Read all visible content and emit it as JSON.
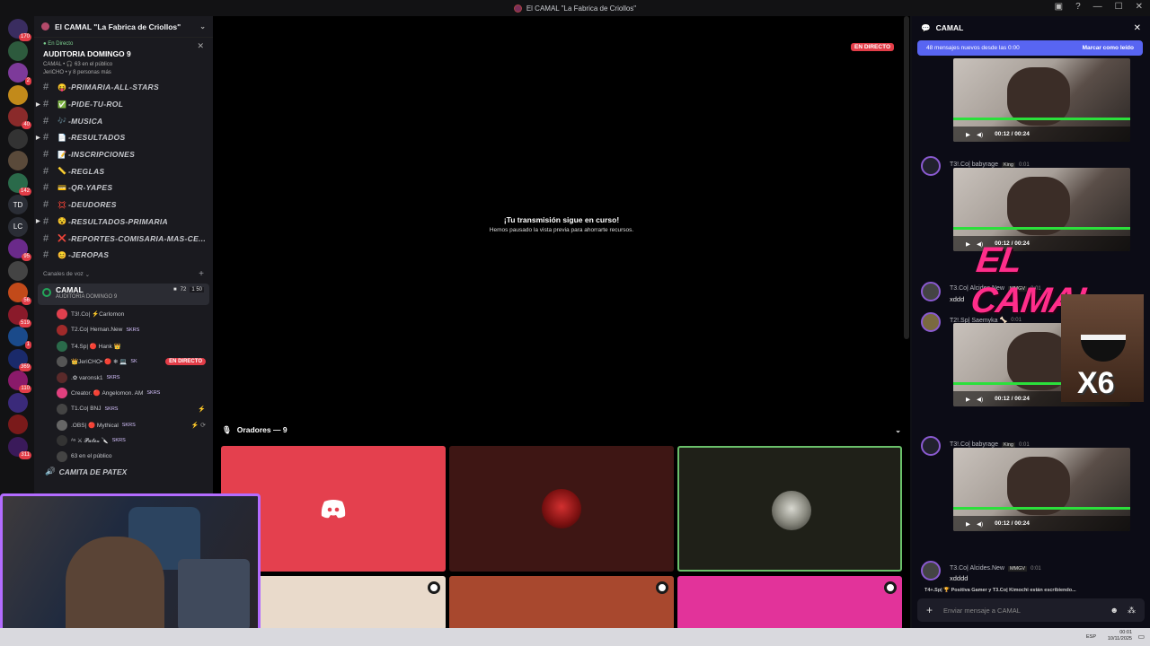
{
  "app": {
    "title": "El CAMAL \"La Fabrica de Criollos\""
  },
  "guilds": [
    {
      "badge": "170",
      "color": "#3a2d60",
      "label": ""
    },
    {
      "badge": "",
      "color": "#2d5a3d",
      "label": ""
    },
    {
      "badge": "2",
      "color": "#7d3a9a",
      "label": ""
    },
    {
      "badge": "",
      "color": "#c28a1a",
      "label": ""
    },
    {
      "badge": "40",
      "color": "#8a2a2a",
      "label": ""
    },
    {
      "badge": "",
      "color": "#333",
      "label": ""
    },
    {
      "badge": "",
      "color": "#5a4a3a",
      "label": ""
    },
    {
      "badge": "142",
      "color": "#2a6a4a",
      "label": ""
    },
    {
      "badge": "",
      "color": "#2a2d35",
      "label": "TD"
    },
    {
      "badge": "",
      "color": "#2a2d35",
      "label": "LC"
    },
    {
      "badge": "95",
      "color": "#6a2a8a",
      "label": ""
    },
    {
      "badge": "",
      "color": "#444",
      "label": ""
    },
    {
      "badge": "56",
      "color": "#c24a1a",
      "label": ""
    },
    {
      "badge": "519",
      "color": "#8a1a2a",
      "label": ""
    },
    {
      "badge": "1",
      "color": "#1a4a8a",
      "label": ""
    },
    {
      "badge": "369",
      "color": "#1a2a6a",
      "label": ""
    },
    {
      "badge": "110",
      "color": "#8a1a6a",
      "label": ""
    },
    {
      "badge": "",
      "color": "#3a2a7a",
      "label": ""
    },
    {
      "badge": "",
      "color": "#7a1a1a",
      "label": ""
    },
    {
      "badge": "311",
      "color": "#3a1a5a",
      "label": ""
    }
  ],
  "sidebar": {
    "server_name": "El CAMAL \"La Fabrica de Criollos\"",
    "event": {
      "status": "En Directo",
      "title": "AUDITORIA DOMINGO 9",
      "sub": "CAMAL • 🎧 63 en el público",
      "participants": "JeriCHO • y 8 personas más"
    },
    "channels": [
      {
        "emoji": "😝",
        "name": "-PRIMARIA-ALL-STARS",
        "arrow": false
      },
      {
        "emoji": "✅",
        "name": "-PIDE-TU-ROL",
        "arrow": true
      },
      {
        "emoji": "🎶",
        "name": "-MUSICA",
        "arrow": false
      },
      {
        "emoji": "📄",
        "name": "-RESULTADOS",
        "arrow": true
      },
      {
        "emoji": "📝",
        "name": "-INSCRIPCIONES",
        "arrow": false
      },
      {
        "emoji": "📏",
        "name": "-REGLAS",
        "arrow": false
      },
      {
        "emoji": "💳",
        "name": "-QR-YAPES",
        "arrow": false
      },
      {
        "emoji": "💢",
        "name": "-DEUDORES",
        "arrow": false
      },
      {
        "emoji": "😵",
        "name": "-RESULTADOS-PRIMARIA",
        "arrow": true
      },
      {
        "emoji": "❌",
        "name": "-REPORTES-COMISARIA-MAS-CE...",
        "arrow": false
      },
      {
        "emoji": "😊",
        "name": "-JEROPAS",
        "arrow": false
      }
    ],
    "voice_category": "Canales de voz",
    "voice_channel": {
      "name": "CAMAL",
      "sub": "AUDITORIA DOMINGO 9",
      "count": "72",
      "limit": "1 50"
    },
    "voice_users": [
      {
        "name": "T3!.Co| ⚡Carlomon",
        "tag": "",
        "live": "",
        "color": "#e0404e",
        "right": ""
      },
      {
        "name": "T2.Co| Hernan.New",
        "tag": "SKRS",
        "live": "",
        "color": "#a02a2a",
        "right": ""
      },
      {
        "name": "T4.Sp| 🔴 Hank 👑",
        "tag": "",
        "live": "",
        "color": "#2a6a4a",
        "right": ""
      },
      {
        "name": "👑JeriCHO• 🔴 ❄ 💻",
        "tag": "SK",
        "live": "EN DIRECTO",
        "color": "#555",
        "right": ""
      },
      {
        "name": ".✿ varonsk1",
        "tag": "SKRS",
        "live": "",
        "color": "#5a2a2a",
        "right": ""
      },
      {
        "name": "Creator. 🔴 Angelomon. AM",
        "tag": "SKRS",
        "live": "",
        "color": "#e0407e",
        "right": ""
      },
      {
        "name": "T1.Co| BNJ",
        "tag": "SKRS",
        "live": "",
        "color": "#444",
        "right": "⚡"
      },
      {
        "name": ".OBS| 🔴 Mythical",
        "tag": "SKRS",
        "live": "",
        "color": "#666",
        "right": "⚡ ⟳"
      },
      {
        "name": "ᴬˢ ⚔ 𝓟𝓪𝓽𝓮𝔁 🔪",
        "tag": "SKRS",
        "live": "",
        "color": "#333",
        "right": ""
      },
      {
        "name": "63 en el público",
        "tag": "",
        "live": "",
        "color": "#444",
        "right": ""
      }
    ],
    "camita": "CAMITA DE PATEX"
  },
  "stage": {
    "live_badge": "EN DIRECTO",
    "paused_title": "¡Tu transmisión sigue en curso!",
    "paused_sub": "Hemos pausado la vista previa para ahorrarte recursos.",
    "speakers_label": "Oradores — 9"
  },
  "chat": {
    "title": "CAMAL",
    "new_messages": "48 mensajes nuevos desde las 0:00",
    "mark_read": "Marcar como leído",
    "video_time": "00:12 / 00:24",
    "messages": [
      {
        "author": "T3!.Co| babyrage",
        "tag": "King",
        "time": "0:01",
        "text": ""
      },
      {
        "author": "T3.Co| Alcides.New",
        "tag": "MMGV",
        "time": "0:01",
        "text": "xddd"
      },
      {
        "author": "T2!.Sp| Saemyka 🦴",
        "tag": "",
        "time": "0:01",
        "text": ""
      },
      {
        "author": "T3!.Co| babyrage",
        "tag": "King",
        "time": "0:01",
        "text": ""
      },
      {
        "author": "T3.Co| Alcides.New",
        "tag": "MMGV",
        "time": "0:01",
        "text": "xdddd"
      }
    ],
    "typing": "T4+.Sp| 🏆 Positiva Gamer y T3.Co| Kimochi están escribiendo...",
    "input_placeholder": "Enviar mensaje a CAMAL"
  },
  "overlay": {
    "brand_text": "EL CAMAL",
    "meme_text": "X6"
  },
  "taskbar": {
    "lang": "ESP",
    "time": "00:01",
    "date": "10/11/2025"
  }
}
